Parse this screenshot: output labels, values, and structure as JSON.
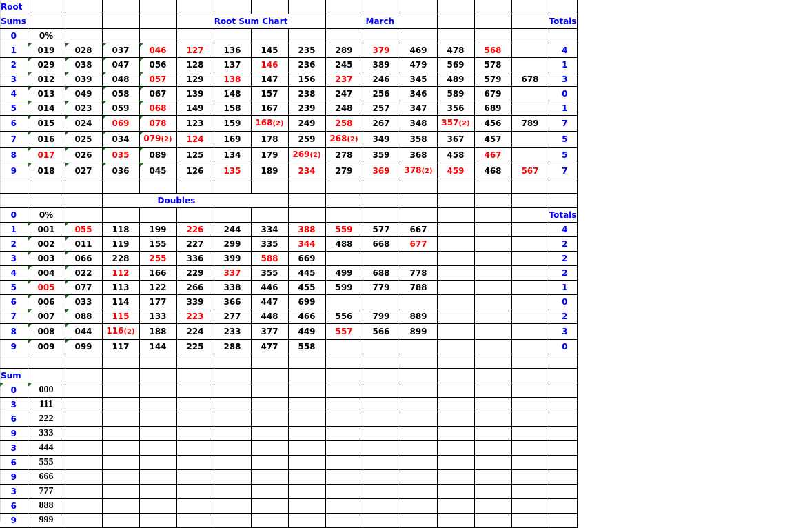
{
  "root_section": {
    "label_line1": "Root",
    "label_line2": "Sums",
    "title": "Root Sum Chart",
    "month": "March",
    "totals_header": "Totals",
    "zero_row": {
      "label": "0",
      "value": "0%"
    },
    "rows": [
      {
        "label": "1",
        "cells": [
          {
            "v": "019"
          },
          {
            "v": "028"
          },
          {
            "v": "037"
          },
          {
            "v": "046",
            "red": true
          },
          {
            "v": "127",
            "red": true
          },
          {
            "v": "136"
          },
          {
            "v": "145"
          },
          {
            "v": "235"
          },
          {
            "v": "289"
          },
          {
            "v": "379",
            "red": true
          },
          {
            "v": "469"
          },
          {
            "v": "478"
          },
          {
            "v": "568",
            "red": true
          },
          {
            "v": ""
          }
        ],
        "total": "4"
      },
      {
        "label": "2",
        "cells": [
          {
            "v": "029"
          },
          {
            "v": "038"
          },
          {
            "v": "047"
          },
          {
            "v": "056"
          },
          {
            "v": "128"
          },
          {
            "v": "137"
          },
          {
            "v": "146",
            "red": true
          },
          {
            "v": "236"
          },
          {
            "v": "245"
          },
          {
            "v": "389"
          },
          {
            "v": "479"
          },
          {
            "v": "569"
          },
          {
            "v": "578"
          },
          {
            "v": ""
          }
        ],
        "total": "1"
      },
      {
        "label": "3",
        "cells": [
          {
            "v": "012"
          },
          {
            "v": "039"
          },
          {
            "v": "048"
          },
          {
            "v": "057",
            "red": true
          },
          {
            "v": "129"
          },
          {
            "v": "138",
            "red": true
          },
          {
            "v": "147"
          },
          {
            "v": "156"
          },
          {
            "v": "237",
            "red": true
          },
          {
            "v": "246"
          },
          {
            "v": "345"
          },
          {
            "v": "489"
          },
          {
            "v": "579"
          },
          {
            "v": "678"
          }
        ],
        "total": "3"
      },
      {
        "label": "4",
        "cells": [
          {
            "v": "013"
          },
          {
            "v": "049"
          },
          {
            "v": "058"
          },
          {
            "v": "067"
          },
          {
            "v": "139"
          },
          {
            "v": "148"
          },
          {
            "v": "157"
          },
          {
            "v": "238"
          },
          {
            "v": "247"
          },
          {
            "v": "256"
          },
          {
            "v": "346"
          },
          {
            "v": "589"
          },
          {
            "v": "679"
          },
          {
            "v": ""
          }
        ],
        "total": "0"
      },
      {
        "label": "5",
        "cells": [
          {
            "v": "014"
          },
          {
            "v": "023"
          },
          {
            "v": "059"
          },
          {
            "v": "068",
            "red": true
          },
          {
            "v": "149"
          },
          {
            "v": "158"
          },
          {
            "v": "167"
          },
          {
            "v": "239"
          },
          {
            "v": "248"
          },
          {
            "v": "257"
          },
          {
            "v": "347"
          },
          {
            "v": "356"
          },
          {
            "v": "689"
          },
          {
            "v": ""
          }
        ],
        "total": "1"
      },
      {
        "label": "6",
        "cells": [
          {
            "v": "015"
          },
          {
            "v": "024"
          },
          {
            "v": "069",
            "red": true
          },
          {
            "v": "078",
            "red": true
          },
          {
            "v": "123"
          },
          {
            "v": "159"
          },
          {
            "v": "168",
            "red": true,
            "sup": "(2)"
          },
          {
            "v": "249"
          },
          {
            "v": "258",
            "red": true
          },
          {
            "v": "267"
          },
          {
            "v": "348"
          },
          {
            "v": "357",
            "red": true,
            "sup": "(2)"
          },
          {
            "v": "456"
          },
          {
            "v": "789"
          }
        ],
        "total": "7"
      },
      {
        "label": "7",
        "cells": [
          {
            "v": "016"
          },
          {
            "v": "025"
          },
          {
            "v": "034"
          },
          {
            "v": "079",
            "red": true,
            "sup": "(2)"
          },
          {
            "v": "124",
            "red": true
          },
          {
            "v": "169"
          },
          {
            "v": "178"
          },
          {
            "v": "259"
          },
          {
            "v": "268",
            "red": true,
            "sup": "(2)"
          },
          {
            "v": "349"
          },
          {
            "v": "358"
          },
          {
            "v": "367"
          },
          {
            "v": "457"
          },
          {
            "v": ""
          }
        ],
        "total": "5"
      },
      {
        "label": "8",
        "cells": [
          {
            "v": "017",
            "red": true
          },
          {
            "v": "026"
          },
          {
            "v": "035",
            "red": true
          },
          {
            "v": "089"
          },
          {
            "v": "125"
          },
          {
            "v": "134"
          },
          {
            "v": "179"
          },
          {
            "v": "269",
            "red": true,
            "sup": "(2)"
          },
          {
            "v": "278"
          },
          {
            "v": "359"
          },
          {
            "v": "368"
          },
          {
            "v": "458"
          },
          {
            "v": "467",
            "red": true
          },
          {
            "v": ""
          }
        ],
        "total": "5"
      },
      {
        "label": "9",
        "cells": [
          {
            "v": "018"
          },
          {
            "v": "027"
          },
          {
            "v": "036"
          },
          {
            "v": "045"
          },
          {
            "v": "126"
          },
          {
            "v": "135",
            "red": true
          },
          {
            "v": "189"
          },
          {
            "v": "234",
            "red": true
          },
          {
            "v": "279"
          },
          {
            "v": "369",
            "red": true
          },
          {
            "v": "378",
            "red": true,
            "sup": "(2)"
          },
          {
            "v": "459",
            "red": true
          },
          {
            "v": "468"
          },
          {
            "v": "567",
            "red": true
          }
        ],
        "total": "7"
      }
    ]
  },
  "doubles_section": {
    "title": "Doubles",
    "totals_header": "Totals",
    "zero_row": {
      "label": "0",
      "value": "0%"
    },
    "rows": [
      {
        "label": "1",
        "cells": [
          {
            "v": "001"
          },
          {
            "v": "055",
            "red": true
          },
          {
            "v": "118"
          },
          {
            "v": "199"
          },
          {
            "v": "226",
            "red": true
          },
          {
            "v": "244"
          },
          {
            "v": "334"
          },
          {
            "v": "388",
            "red": true
          },
          {
            "v": "559",
            "red": true
          },
          {
            "v": "577"
          },
          {
            "v": "667"
          },
          {
            "v": ""
          },
          {
            "v": ""
          },
          {
            "v": ""
          }
        ],
        "total": "4"
      },
      {
        "label": "2",
        "cells": [
          {
            "v": "002"
          },
          {
            "v": "011"
          },
          {
            "v": "119"
          },
          {
            "v": "155"
          },
          {
            "v": "227"
          },
          {
            "v": "299"
          },
          {
            "v": "335"
          },
          {
            "v": "344",
            "red": true
          },
          {
            "v": "488"
          },
          {
            "v": "668"
          },
          {
            "v": "677",
            "red": true
          },
          {
            "v": ""
          },
          {
            "v": ""
          },
          {
            "v": ""
          }
        ],
        "total": "2"
      },
      {
        "label": "3",
        "cells": [
          {
            "v": "003"
          },
          {
            "v": "066"
          },
          {
            "v": "228"
          },
          {
            "v": "255",
            "red": true
          },
          {
            "v": "336"
          },
          {
            "v": "399"
          },
          {
            "v": "588",
            "red": true
          },
          {
            "v": "669"
          },
          {
            "v": ""
          },
          {
            "v": ""
          },
          {
            "v": ""
          },
          {
            "v": ""
          },
          {
            "v": ""
          },
          {
            "v": ""
          }
        ],
        "total": "2"
      },
      {
        "label": "4",
        "cells": [
          {
            "v": "004"
          },
          {
            "v": "022"
          },
          {
            "v": "112",
            "red": true
          },
          {
            "v": "166"
          },
          {
            "v": "229"
          },
          {
            "v": "337",
            "red": true
          },
          {
            "v": "355"
          },
          {
            "v": "445"
          },
          {
            "v": "499"
          },
          {
            "v": "688"
          },
          {
            "v": "778"
          },
          {
            "v": ""
          },
          {
            "v": ""
          },
          {
            "v": ""
          }
        ],
        "total": "2"
      },
      {
        "label": "5",
        "cells": [
          {
            "v": "005",
            "red": true
          },
          {
            "v": "077"
          },
          {
            "v": "113"
          },
          {
            "v": "122"
          },
          {
            "v": "266"
          },
          {
            "v": "338"
          },
          {
            "v": "446"
          },
          {
            "v": "455"
          },
          {
            "v": "599"
          },
          {
            "v": "779"
          },
          {
            "v": "788"
          },
          {
            "v": ""
          },
          {
            "v": ""
          },
          {
            "v": ""
          }
        ],
        "total": "1"
      },
      {
        "label": "6",
        "cells": [
          {
            "v": "006"
          },
          {
            "v": "033"
          },
          {
            "v": "114"
          },
          {
            "v": "177"
          },
          {
            "v": "339"
          },
          {
            "v": "366"
          },
          {
            "v": "447"
          },
          {
            "v": "699"
          },
          {
            "v": ""
          },
          {
            "v": ""
          },
          {
            "v": ""
          },
          {
            "v": ""
          },
          {
            "v": ""
          },
          {
            "v": ""
          }
        ],
        "total": "0"
      },
      {
        "label": "7",
        "cells": [
          {
            "v": "007"
          },
          {
            "v": "088"
          },
          {
            "v": "115",
            "red": true
          },
          {
            "v": "133"
          },
          {
            "v": "223",
            "red": true
          },
          {
            "v": "277"
          },
          {
            "v": "448"
          },
          {
            "v": "466"
          },
          {
            "v": "556"
          },
          {
            "v": "799"
          },
          {
            "v": "889"
          },
          {
            "v": ""
          },
          {
            "v": ""
          },
          {
            "v": ""
          }
        ],
        "total": "2"
      },
      {
        "label": "8",
        "cells": [
          {
            "v": "008"
          },
          {
            "v": "044"
          },
          {
            "v": "116",
            "red": true,
            "sup": "(2)"
          },
          {
            "v": "188"
          },
          {
            "v": "224"
          },
          {
            "v": "233"
          },
          {
            "v": "377"
          },
          {
            "v": "449"
          },
          {
            "v": "557",
            "red": true
          },
          {
            "v": "566"
          },
          {
            "v": "899"
          },
          {
            "v": ""
          },
          {
            "v": ""
          },
          {
            "v": ""
          }
        ],
        "total": "3"
      },
      {
        "label": "9",
        "cells": [
          {
            "v": "009"
          },
          {
            "v": "099"
          },
          {
            "v": "117"
          },
          {
            "v": "144"
          },
          {
            "v": "225"
          },
          {
            "v": "288"
          },
          {
            "v": "477"
          },
          {
            "v": "558"
          },
          {
            "v": ""
          },
          {
            "v": ""
          },
          {
            "v": ""
          },
          {
            "v": ""
          },
          {
            "v": ""
          },
          {
            "v": ""
          }
        ],
        "total": "0"
      }
    ]
  },
  "triples_section": {
    "label": "Sum",
    "rows": [
      {
        "label": "0",
        "value": "000"
      },
      {
        "label": "3",
        "value": "111"
      },
      {
        "label": "6",
        "value": "222"
      },
      {
        "label": "9",
        "value": "333"
      },
      {
        "label": "3",
        "value": "444"
      },
      {
        "label": "6",
        "value": "555"
      },
      {
        "label": "9",
        "value": "666"
      },
      {
        "label": "3",
        "value": "777"
      },
      {
        "label": "6",
        "value": "888"
      },
      {
        "label": "9",
        "value": "999"
      }
    ]
  },
  "colors": {
    "label_blue": "#0000ff",
    "highlight_red": "#ff0000",
    "text_black": "#000000",
    "flag_green": "#1a7a1a"
  }
}
